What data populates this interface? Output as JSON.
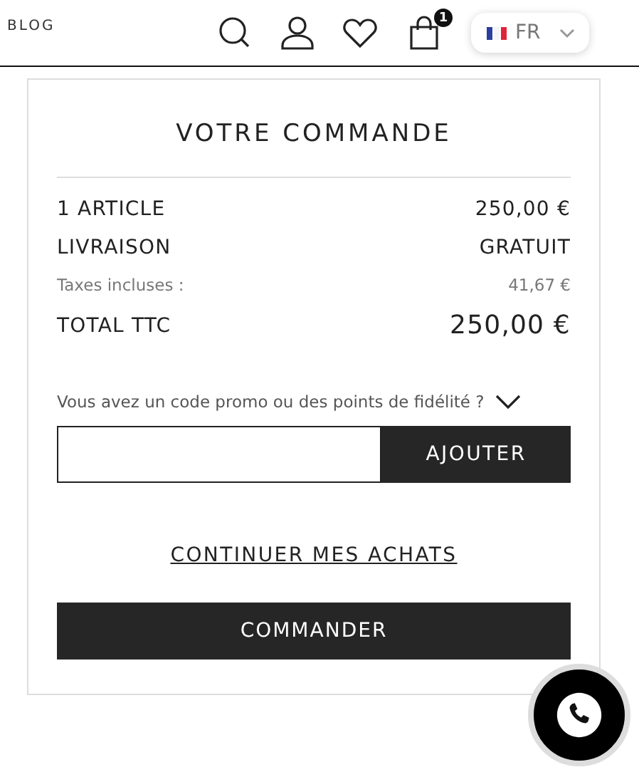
{
  "header": {
    "nav_link": "BLOG",
    "cart_count": "1",
    "language": "FR"
  },
  "order": {
    "title": "VOTRE COMMANDE",
    "rows": [
      {
        "kind": "main",
        "label": "1 ARTICLE",
        "value": "250,00 €"
      },
      {
        "kind": "main",
        "label": "LIVRAISON",
        "value": "GRATUIT"
      },
      {
        "kind": "small",
        "label": "Taxes incluses :",
        "value": "41,67 €"
      },
      {
        "kind": "total",
        "label": "TOTAL TTC",
        "value": "250,00 €"
      }
    ],
    "promo": {
      "label": "Vous avez un code promo ou des points de fidélité ?",
      "expanded": false,
      "button": "AJOUTER"
    },
    "continue_link": "CONTINUER MES ACHATS",
    "checkout_button": "COMMANDER"
  }
}
